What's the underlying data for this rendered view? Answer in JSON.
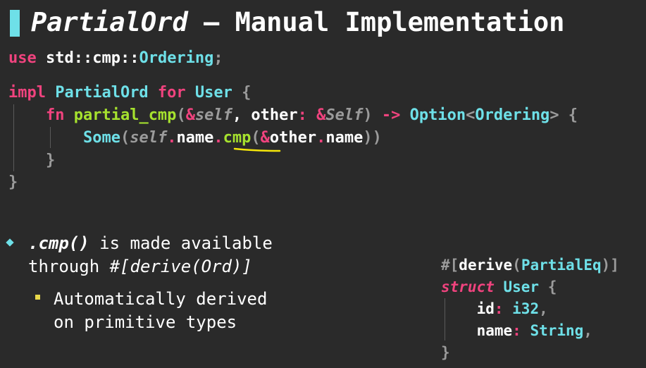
{
  "title": {
    "part1": "PartialOrd",
    "part2": " – Manual Implementation"
  },
  "code_main": {
    "l1_kw": "use",
    "l1_path": " std::cmp::",
    "l1_type": "Ordering",
    "l1_semi": ";",
    "l2_kw": "impl",
    "l2_trait": " PartialOrd",
    "l2_for": " for",
    "l2_type": " User",
    "l2_brace": " {",
    "l3_fn": "    fn",
    "l3_name": " partial_cmp",
    "l3_open": "(",
    "l3_amp": "&",
    "l3_self": "self",
    "l3_comma": ", other",
    "l3_colon": ":",
    "l3_amp2": " &",
    "l3_Self": "Self",
    "l3_close": ")",
    "l3_arrow": " ->",
    "l3_opt": " Option",
    "l3_lt": "<",
    "l3_ord": "Ordering",
    "l3_gt": ">",
    "l3_brace": " {",
    "l4_some": "        Some",
    "l4_p1": "(",
    "l4_self": "self",
    "l4_dot1": ".",
    "l4_name": "name",
    "l4_dot2": ".",
    "l4_cmp": "cmp",
    "l4_p2": "(",
    "l4_amp": "&",
    "l4_other": "other",
    "l4_dot3": ".",
    "l4_name2": "name",
    "l4_p3": "))",
    "l5": "    }",
    "l6": "}"
  },
  "bullets": {
    "b1_code": ".cmp()",
    "b1_rest": " is made available",
    "b1_line2a": "through ",
    "b1_line2b": "#[derive(Ord)]",
    "b2_line1": "Automatically derived",
    "b2_line2": "on primitive types"
  },
  "code_side": {
    "l1_hash": "#[",
    "l1_derive": "derive",
    "l1_p": "(",
    "l1_trait": "PartialEq",
    "l1_end": ")]",
    "l2_struct": "struct",
    "l2_type": " User",
    "l2_brace": " {",
    "l3_id": "    id",
    "l3_colon": ":",
    "l3_type": " i32",
    "l3_comma": ",",
    "l4_name": "    name",
    "l4_colon": ":",
    "l4_type": " String",
    "l4_comma": ",",
    "l5": "}"
  },
  "colors": {
    "background": "#2a2a2a",
    "keyword": "#f0437e",
    "type": "#6ee0e8",
    "function": "#a6e22e",
    "underline": "#f5e60a"
  }
}
